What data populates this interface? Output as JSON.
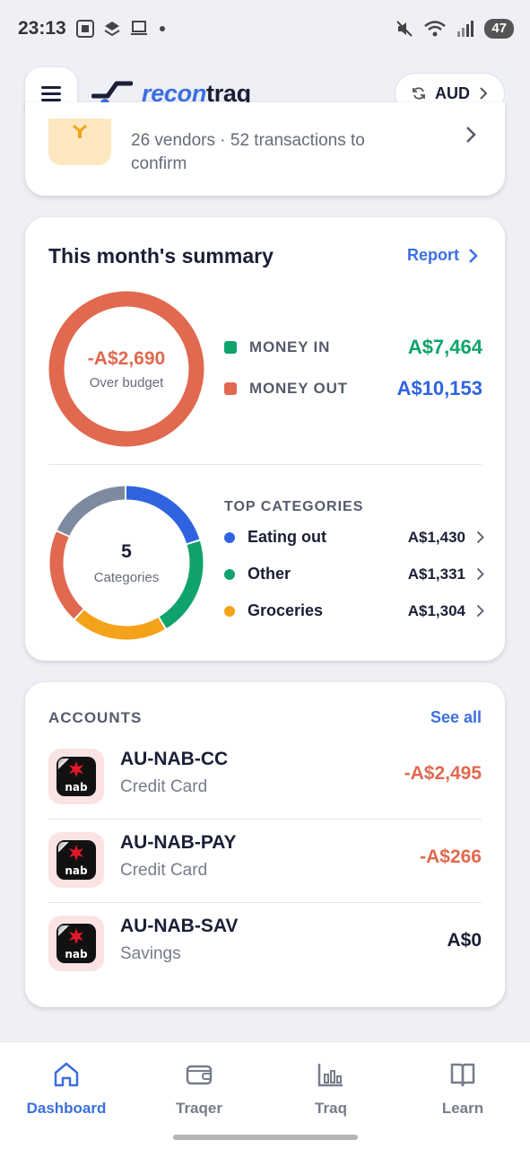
{
  "status_bar": {
    "time": "23:13",
    "battery": "47"
  },
  "header": {
    "logo_part1": "recon",
    "logo_part2": "traq",
    "currency": "AUD"
  },
  "vendor_card": {
    "text": "26 vendors · 52 transactions to confirm"
  },
  "summary": {
    "title": "This month's summary",
    "report_label": "Report",
    "budget_amount": "-A$2,690",
    "budget_label": "Over budget",
    "money_in_label": "MONEY IN",
    "money_in_value": "A$7,464",
    "money_out_label": "MONEY OUT",
    "money_out_value": "A$10,153",
    "categories_count": "5",
    "categories_label": "Categories",
    "top_categories_title": "TOP CATEGORIES",
    "top_categories": [
      {
        "name": "Eating out",
        "amount": "A$1,430",
        "color": "#2f63e0"
      },
      {
        "name": "Other",
        "amount": "A$1,331",
        "color": "#10a36b"
      },
      {
        "name": "Groceries",
        "amount": "A$1,304",
        "color": "#f5a21b"
      }
    ],
    "colors": {
      "money_in": "#10a36b",
      "money_out": "#e0694f",
      "money_out_value": "#2f63e0",
      "over_budget": "#e0694f"
    }
  },
  "accounts": {
    "title": "ACCOUNTS",
    "see_all": "See all",
    "items": [
      {
        "name": "AU-NAB-CC",
        "type": "Credit Card",
        "balance": "-A$2,495",
        "color": "#e0694f"
      },
      {
        "name": "AU-NAB-PAY",
        "type": "Credit Card",
        "balance": "-A$266",
        "color": "#e0694f"
      },
      {
        "name": "AU-NAB-SAV",
        "type": "Savings",
        "balance": "A$0",
        "color": "#1a1f36"
      }
    ],
    "logo_text": "nab"
  },
  "nav": {
    "items": [
      {
        "label": "Dashboard",
        "icon": "home-icon",
        "active": true
      },
      {
        "label": "Traqer",
        "icon": "wallet-icon",
        "active": false
      },
      {
        "label": "Traq",
        "icon": "chart-icon",
        "active": false
      },
      {
        "label": "Learn",
        "icon": "book-icon",
        "active": false
      }
    ]
  }
}
